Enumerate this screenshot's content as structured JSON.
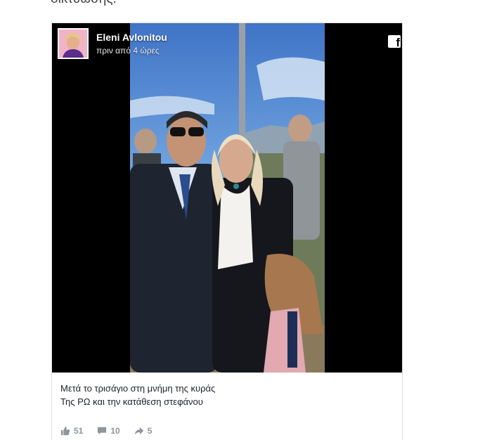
{
  "page": {
    "top_text": "δικτύωσης."
  },
  "post": {
    "author_name": "Eleni Avlonitou",
    "timestamp": "πριν από 4 ώρες",
    "caption_lines": [
      "Μετά το τρισάγιο στη μνήμη της κυράς",
      "Της ΡΩ και την κατάθεση στεφάνου"
    ],
    "likes": "51",
    "comments": "10",
    "shares": "5",
    "platform_icon": "facebook-icon"
  },
  "colors": {
    "media_background": "#000000",
    "meta_text": "#90949c",
    "body_text": "#1d2129"
  }
}
